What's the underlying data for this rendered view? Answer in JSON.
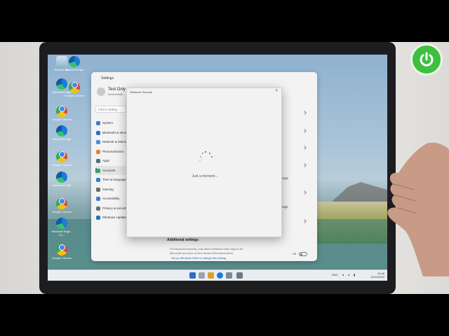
{
  "desktop": {
    "icons": [
      {
        "label": "Recycle Bin",
        "icon": "recycle-bin-icon"
      },
      {
        "label": "Microsoft Edge",
        "icon": "edge-icon"
      },
      {
        "label": "Microsoft Edge",
        "icon": "edge-icon"
      },
      {
        "label": "Google Chrome",
        "icon": "chrome-icon"
      },
      {
        "label": "Google Chrome",
        "icon": "chrome-icon"
      },
      {
        "label": "Microsoft Edge",
        "icon": "edge-icon"
      },
      {
        "label": "Google Chrome",
        "icon": "chrome-icon"
      },
      {
        "label": "Microsoft Edge",
        "icon": "edge-icon"
      },
      {
        "label": "Google Chrome",
        "icon": "chrome-icon"
      },
      {
        "label": "Microsoft Edge - Co...",
        "icon": "edge-icon"
      },
      {
        "label": "Google Chrome",
        "icon": "chrome-icon"
      }
    ]
  },
  "settings": {
    "title": "Settings",
    "user": {
      "name": "Test Only",
      "sub": "hardreset@..."
    },
    "find_placeholder": "Find a setting",
    "nav": [
      {
        "label": "System",
        "color": "#3b82c4"
      },
      {
        "label": "Bluetooth & devices",
        "color": "#2a6fc0"
      },
      {
        "label": "Network & internet",
        "color": "#4a90d9"
      },
      {
        "label": "Personalization",
        "color": "#d88a2a"
      },
      {
        "label": "Apps",
        "color": "#5b6b7a"
      },
      {
        "label": "Accounts",
        "color": "#3aa35a"
      },
      {
        "label": "Time & language",
        "color": "#2f7fc1"
      },
      {
        "label": "Gaming",
        "color": "#6b6b6b"
      },
      {
        "label": "Accessibility",
        "color": "#3a7bd5"
      },
      {
        "label": "Privacy & security",
        "color": "#6d6d6d"
      },
      {
        "label": "Windows Update",
        "color": "#2a6fc0"
      }
    ],
    "active_index": 5,
    "fragments": [
      "ange",
      "hange"
    ],
    "additional_settings": "Additional settings",
    "bottom_line1": "For improved security, only allow Windows Hello sign-in for",
    "bottom_line2": "Microsoft accounts on this device (Recommended)",
    "bottom_link": "Set up Windows Hello to change this setting",
    "toggle_label": "Off"
  },
  "dialog": {
    "title": "Windows Security",
    "close": "×",
    "status": "Just a moment..."
  },
  "taskbar": {
    "tray": "ENG",
    "time": "16:48",
    "date": "12/22/2022"
  }
}
